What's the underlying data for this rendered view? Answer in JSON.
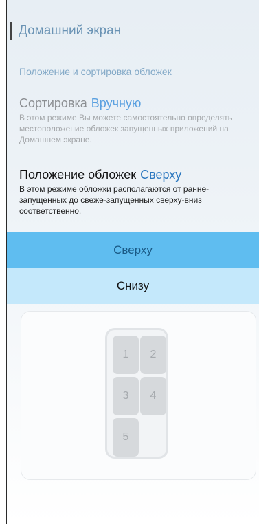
{
  "header": {
    "title": "Домашний экран"
  },
  "section": {
    "title": "Положение и сортировка обложек"
  },
  "sorting": {
    "label": "Сортировка",
    "value": "Вручную",
    "description": "В этом режиме Вы можете самостоятельно определять местоположение обложек запущенных приложений на Домашнем экране."
  },
  "position": {
    "label": "Положение обложек",
    "value": "Сверху",
    "description": "В этом режиме обложки располагаются от ранне-запущенных до свеже-запущенных сверху-вниз соответственно."
  },
  "options": [
    {
      "label": "Сверху"
    },
    {
      "label": "Снизу"
    }
  ],
  "preview": {
    "tiles": [
      "1",
      "2",
      "3",
      "4",
      "5"
    ]
  },
  "colors": {
    "accent_selected": "#5fbdf0",
    "accent_unselected": "#c4e8fb",
    "header_text": "#6a93b4"
  }
}
